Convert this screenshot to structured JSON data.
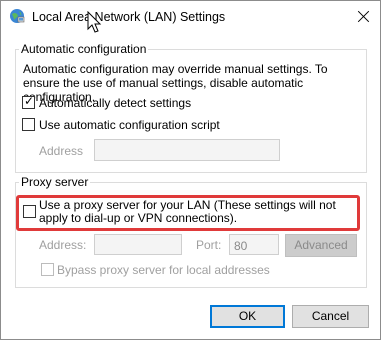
{
  "window": {
    "title": "Local Area Network (LAN) Settings"
  },
  "auto_config": {
    "legend": "Automatic configuration",
    "description": "Automatic configuration may override manual settings.  To ensure the use of manual settings, disable automatic configuration.",
    "detect_label": "Automatically detect settings",
    "detect_checked": true,
    "script_label": "Use automatic configuration script",
    "script_checked": false,
    "address_label": "Address",
    "address_value": ""
  },
  "proxy": {
    "legend": "Proxy server",
    "use_proxy_label": "Use a proxy server for your LAN (These settings will not apply to dial-up or VPN connections).",
    "use_proxy_checked": false,
    "address_label": "Address:",
    "address_value": "",
    "port_label": "Port:",
    "port_value": "80",
    "advanced_label": "Advanced",
    "bypass_label": "Bypass proxy server for local addresses",
    "bypass_checked": false
  },
  "buttons": {
    "ok_label": "OK",
    "cancel_label": "Cancel"
  },
  "colors": {
    "highlight": "#e03a3a",
    "default_button_border": "#0078d7"
  },
  "icons": [
    "network-globe-icon",
    "close-icon",
    "mouse-cursor-icon",
    "checkmark-icon"
  ]
}
